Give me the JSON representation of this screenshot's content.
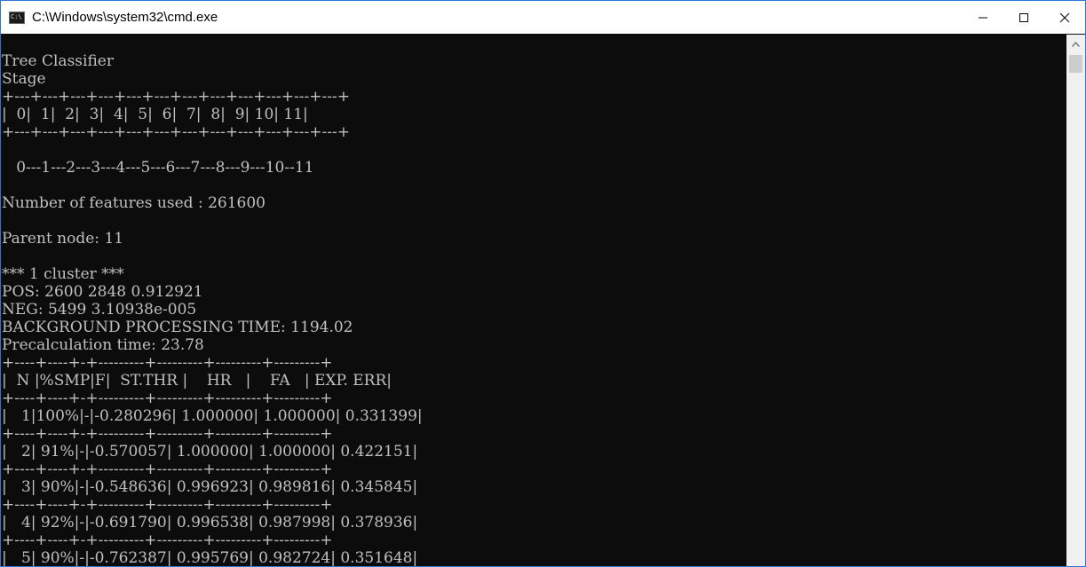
{
  "window": {
    "title": "C:\\Windows\\system32\\cmd.exe",
    "app_icon_text": "C:\\"
  },
  "icons": {
    "app": "cmd-icon",
    "minimize": "minimize-icon",
    "maximize": "maximize-icon",
    "close": "close-icon",
    "scroll_up": "chevron-up-icon"
  },
  "console": {
    "lines": [
      "Tree Classifier",
      "Stage",
      "+---+---+---+---+---+---+---+---+---+---+---+---+",
      "|  0|  1|  2|  3|  4|  5|  6|  7|  8|  9| 10| 11|",
      "+---+---+---+---+---+---+---+---+---+---+---+---+",
      "",
      "   0---1---2---3---4---5---6---7---8---9---10--11",
      "",
      "Number of features used : 261600",
      "",
      "Parent node: 11",
      "",
      "*** 1 cluster ***",
      "POS: 2600 2848 0.912921",
      "NEG: 5499 3.10938e-005",
      "BACKGROUND PROCESSING TIME: 1194.02",
      "Precalculation time: 23.78",
      "+----+----+-+---------+---------+---------+---------+",
      "|  N |%SMP|F|  ST.THR |    HR   |    FA   | EXP. ERR|",
      "+----+----+-+---------+---------+---------+---------+",
      "|   1|100%|-|-0.280296| 1.000000| 1.000000| 0.331399|",
      "+----+----+-+---------+---------+---------+---------+",
      "|   2| 91%|-|-0.570057| 1.000000| 1.000000| 0.422151|",
      "+----+----+-+---------+---------+---------+---------+",
      "|   3| 90%|-|-0.548636| 0.996923| 0.989816| 0.345845|",
      "+----+----+-+---------+---------+---------+---------+",
      "|   4| 92%|-|-0.691790| 0.996538| 0.987998| 0.378936|",
      "+----+----+-+---------+---------+---------+---------+",
      "|   5| 90%|-|-0.762387| 0.995769| 0.982724| 0.351648|"
    ]
  }
}
